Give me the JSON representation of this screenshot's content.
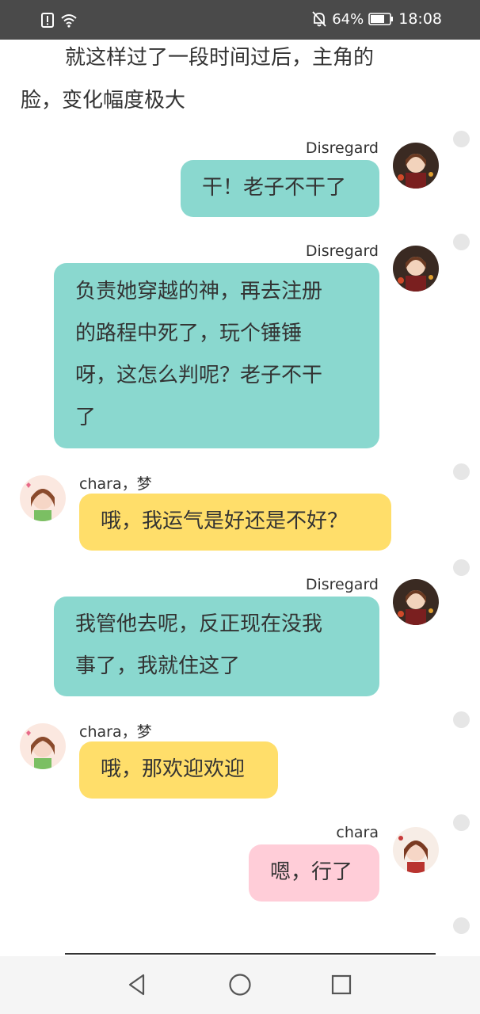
{
  "status_bar": {
    "battery_percent": "64%",
    "time": "18:08",
    "icons": [
      "alert-icon",
      "wifi-icon",
      "mute-bell-icon",
      "battery-icon"
    ]
  },
  "narration": {
    "line1": "就这样过了一段时间过后，主角的",
    "line2": "脸，变化幅度极大"
  },
  "messages": [
    {
      "sender": "Disregard",
      "side": "right",
      "color": "teal",
      "lines": [
        "干！老子不干了"
      ]
    },
    {
      "sender": "Disregard",
      "side": "right",
      "color": "teal",
      "lines": [
        "负责她穿越的神，再去注册",
        "的路程中死了，玩个锤锤",
        "呀，这怎么判呢？老子不干",
        "了"
      ]
    },
    {
      "sender": "chara，梦",
      "side": "left",
      "color": "yellow",
      "lines": [
        "哦，我运气是好还是不好？"
      ]
    },
    {
      "sender": "Disregard",
      "side": "right",
      "color": "teal",
      "lines": [
        "我管他去呢，反正现在没我",
        "事了，我就住这了"
      ]
    },
    {
      "sender": "chara，梦",
      "side": "left",
      "color": "yellow",
      "lines": [
        "哦，那欢迎欢迎"
      ]
    },
    {
      "sender": "chara",
      "side": "right",
      "color": "pink",
      "lines": [
        "嗯，行了"
      ]
    }
  ],
  "colors": {
    "teal": "#8ad8cf",
    "yellow": "#ffde6a",
    "pink": "#ffcdd8",
    "status_bar": "#4a4a4a"
  },
  "nav_bar": {
    "buttons": [
      "back-icon",
      "home-icon",
      "recents-icon"
    ]
  }
}
